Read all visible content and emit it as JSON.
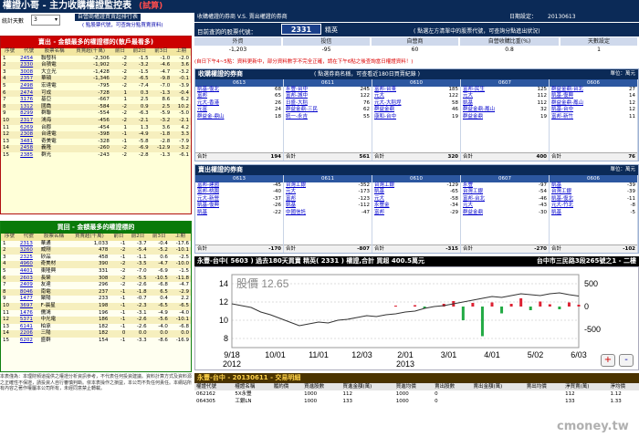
{
  "header": {
    "title": "權證小哥 - 主力收購權證監控表",
    "title_tag": "(試算)"
  },
  "left": {
    "days_label": "統計天數",
    "days_value": "3",
    "hint_line1": "自營商權證買賣超排行表",
    "hint_line2": "( 點股票代號，可查詢分點買賣資料)",
    "buy_title": "賣出 - 金額最多的權證標的(散戶最看多)",
    "sell_title": "買回 - 金額最多的權證標的",
    "cols": [
      "序號",
      "代號",
      "股票名稱",
      "買賣超(千萬)",
      "前日",
      "前2日",
      "前3日",
      "上期"
    ],
    "buy_rows": [
      [
        "1",
        "2454",
        "聯發科",
        "-2,306",
        "-2",
        "-1.5",
        "-1.0",
        "-2.0"
      ],
      [
        "2",
        "2330",
        "台積電",
        "-1,902",
        "-2",
        "-3.2",
        "-4.6",
        "3.6"
      ],
      [
        "3",
        "3008",
        "大立光",
        "-1,428",
        "-2",
        "-1.5",
        "-4.7",
        "-3.2"
      ],
      [
        "4",
        "2357",
        "華碩",
        "-1,346",
        "-2",
        "-6.5",
        "-9.8",
        "-0.1"
      ],
      [
        "5",
        "2498",
        "宏達電",
        "-795",
        "-2",
        "-7.4",
        "-7.0",
        "-3.9"
      ],
      [
        "6",
        "2474",
        "可成",
        "-728",
        "1",
        "0.3",
        "-1.3",
        "-0.4"
      ],
      [
        "7",
        "3176",
        "基亞",
        "-667",
        "1",
        "2.5",
        "8.6",
        "6.2"
      ],
      [
        "8",
        "1312",
        "國喬",
        "-584",
        "-2",
        "0.9",
        "2.5",
        "10.2"
      ],
      [
        "9",
        "8299",
        "群聯",
        "-554",
        "-2",
        "-6.3",
        "-5.9",
        "-5.0"
      ],
      [
        "10",
        "2317",
        "鴻海",
        "-456",
        "-2",
        "-2.1",
        "-3.2",
        "-2.1"
      ],
      [
        "11",
        "6269",
        "台郡",
        "-454",
        "1",
        "1.3",
        "3.6",
        "4.2"
      ],
      [
        "12",
        "2308",
        "台達電",
        "-398",
        "-1",
        "-4.9",
        "-1.8",
        "3.3"
      ],
      [
        "13",
        "3481",
        "奇美電",
        "-328",
        "-1",
        "-5.8",
        "-2.8",
        "-7.9"
      ],
      [
        "14",
        "2458",
        "義隆",
        "-260",
        "-2",
        "-6.9",
        "-12.9",
        "-3.2"
      ],
      [
        "15",
        "2385",
        "群光",
        "-243",
        "-2",
        "-2.8",
        "-1.3",
        "-6.1"
      ]
    ],
    "sell_rows": [
      [
        "1",
        "2313",
        "華通",
        "1,033",
        "-1",
        "-3.7",
        "-0.4",
        "-17.6"
      ],
      [
        "2",
        "3260",
        "威剛",
        "478",
        "-2",
        "-5.4",
        "-5.2",
        "-10.1"
      ],
      [
        "3",
        "2325",
        "矽品",
        "458",
        "-1",
        "-1.1",
        "0.6",
        "-2.5"
      ],
      [
        "4",
        "4960",
        "奇美材",
        "390",
        "-2",
        "-3.5",
        "-4.7",
        "-10.0"
      ],
      [
        "5",
        "4401",
        "東隆興",
        "331",
        "-2",
        "-7.0",
        "-6.9",
        "-1.5"
      ],
      [
        "6",
        "2603",
        "長榮",
        "308",
        "-2",
        "-5.5",
        "-10.5",
        "-11.8"
      ],
      [
        "7",
        "2409",
        "友達",
        "296",
        "-2",
        "-2.6",
        "-6.8",
        "-4.7"
      ],
      [
        "8",
        "8046",
        "南電",
        "237",
        "-1",
        "-1.8",
        "6.5",
        "-2.9"
      ],
      [
        "9",
        "1477",
        "聚陽",
        "233",
        "-1",
        "-0.7",
        "0.4",
        "2.2"
      ],
      [
        "10",
        "3697",
        "F-晨星",
        "198",
        "-1",
        "-2.3",
        "-6.5",
        "-6.5"
      ],
      [
        "11",
        "1476",
        "儒鴻",
        "196",
        "-1",
        "-3.1",
        "-4.9",
        "-4.0"
      ],
      [
        "12",
        "5371",
        "中光電",
        "186",
        "-1",
        "-2.6",
        "-5.6",
        "-10.1"
      ],
      [
        "13",
        "6141",
        "柏承",
        "182",
        "-1",
        "-2.6",
        "-4.0",
        "-6.8"
      ],
      [
        "14",
        "2206",
        "三陽",
        "182",
        "0",
        "0.0",
        "0.0",
        "0.0"
      ],
      [
        "15",
        "6202",
        "盛群",
        "154",
        "-1",
        "-3.3",
        "-8.6",
        "-16.9"
      ]
    ],
    "note": "本表僅為：本理財頻道提供之權證分析資訊參考，不代表任何投資建議。資料計算方式及資料源之正確性不保證，請投資人自行審慎判斷。依本表操作之損益，本公司不負任何責任。本網站所有內容之著作權屬本公司所有，未經同意禁止轉載。"
  },
  "info": {
    "header_left": "收購權證的券商 V.S. 賣出權證的券商",
    "date_label": "日期設定：",
    "date_value": "20130613",
    "stock_label": "目前查詢的股票代號：",
    "stock_code": "2331",
    "stock_name": "精英",
    "stock_hint": "( 點選左方清單中的股票代號，可查詢分點進出狀況)",
    "metric_heads": [
      "外資",
      "投信",
      "自營商",
      "自營收購比重(%)",
      "天數設定"
    ],
    "metric_vals": [
      "-1,203",
      "-95",
      "60",
      "0.8",
      "1"
    ],
    "red_note": "(自日下午4~5點：資料更新中，部分資料數字不完全正確，請在下午6點之後查詢當日權證資料！)"
  },
  "buy_section": {
    "title": "收購權證的券商",
    "sub": "( 點選券商名稱，可查看近180日買賣紀錄 )",
    "unit": "單位：萬元",
    "dates": [
      "0613",
      "0611",
      "0610",
      "0607",
      "0606"
    ],
    "cols": [
      {
        "rows": [
          [
            "凱基-復北",
            "68"
          ],
          [
            "富邦",
            "65"
          ],
          [
            "元大-香港",
            "26"
          ],
          [
            "元富",
            "24"
          ],
          [
            "群益金-鼎山",
            "18"
          ]
        ],
        "total": "194"
      },
      {
        "rows": [
          [
            "永豐-台中",
            "245"
          ],
          [
            "富邦-城中",
            "122"
          ],
          [
            "日盛-大稻",
            "76"
          ],
          [
            "群益金鼎-三民",
            "62"
          ],
          [
            "統一-永吉",
            "55"
          ]
        ],
        "total": "561"
      },
      {
        "rows": [
          [
            "富邦-台東",
            "185"
          ],
          [
            "元大",
            "122"
          ],
          [
            "元大-大稻埕",
            "58"
          ],
          [
            "群益金鼎",
            "46"
          ],
          [
            "康和-台中",
            "19"
          ]
        ],
        "total": "320"
      },
      {
        "rows": [
          [
            "富邦-民生",
            "125"
          ],
          [
            "元大",
            "112"
          ],
          [
            "凱基",
            "112"
          ],
          [
            "群益金鼎-鳳山",
            "32"
          ],
          [
            "群益金鼎",
            "19"
          ]
        ],
        "total": "400"
      },
      {
        "rows": [
          [
            "群益金鼎-台北",
            "27"
          ],
          [
            "凱基-復興",
            "14"
          ],
          [
            "群益金鼎-鳳山",
            "12"
          ],
          [
            "凱基-台中",
            "12"
          ],
          [
            "富邦-新竹",
            "11"
          ]
        ],
        "total": "76"
      }
    ],
    "total_label": "合計"
  },
  "sell_section": {
    "title": "賣出權證的券商",
    "unit": "單位：萬元",
    "dates": [
      "0613",
      "0611",
      "0610",
      "0607",
      "0606"
    ],
    "cols": [
      {
        "rows": [
          [
            "富邦-建國",
            "-45"
          ],
          [
            "富邦-桃園",
            "-40"
          ],
          [
            "元大-新營",
            "-37"
          ],
          [
            "凱基-復興",
            "-26"
          ],
          [
            "凱基",
            "-22"
          ]
        ],
        "total": "-170"
      },
      {
        "rows": [
          [
            "台灣工銀",
            "-352"
          ],
          [
            "元大",
            "-173"
          ],
          [
            "富邦",
            "-123"
          ],
          [
            "凱基",
            "-112"
          ],
          [
            "中國信託",
            "-47"
          ]
        ],
        "total": "-807"
      },
      {
        "rows": [
          [
            "台灣工銀",
            "-129"
          ],
          [
            "凱基",
            "-65"
          ],
          [
            "元大",
            "-58"
          ],
          [
            "永豐金",
            "-34"
          ],
          [
            "富邦",
            "-29"
          ]
        ],
        "total": "-315"
      },
      {
        "rows": [
          [
            "永豐",
            "-97"
          ],
          [
            "台灣工銀",
            "-54"
          ],
          [
            "富邦-台北",
            "-46"
          ],
          [
            "元大",
            "-43"
          ],
          [
            "群益金鼎",
            "-30"
          ]
        ],
        "total": "-270"
      },
      {
        "rows": [
          [
            "凱基",
            "-39"
          ],
          [
            "台灣工銀",
            "-39"
          ],
          [
            "凱基-復北",
            "-11"
          ],
          [
            "元大-竹北",
            "-8"
          ],
          [
            "凱基",
            "-5"
          ]
        ],
        "total": "-102"
      }
    ],
    "total_label": "合計"
  },
  "chart_bar": {
    "left": "永豐-台中( 5603 ) 過去180天買賣 精英( 2331 ) 權證,合計 買超 400.5萬元",
    "right": "台中市三民路3段265號之1 - 二樓"
  },
  "chart_data": {
    "type": "line",
    "price_label": "股價 12.65",
    "x_ticks": [
      "9/18",
      "10/01",
      "11/01",
      "12/03",
      "2/01",
      "3/01",
      "4/01",
      "5/02",
      "6/03"
    ],
    "year_ticks": [
      "2012",
      "2013"
    ],
    "y_left": {
      "ticks": [
        "8",
        "10",
        "12",
        "14"
      ],
      "range": [
        7,
        15
      ]
    },
    "y_right": {
      "ticks": [
        "500",
        "0",
        "-500"
      ],
      "range": [
        -900,
        700
      ]
    },
    "price": [
      11.8,
      11.6,
      11.4,
      10.9,
      10.6,
      10.2,
      9.8,
      9.4,
      9.6,
      9.8,
      9.7,
      10.0,
      10.1,
      10.3,
      10.5,
      10.4,
      10.6,
      10.7,
      10.9,
      11.0,
      11.3,
      11.5,
      11.6,
      11.8,
      12.0,
      12.2,
      12.4,
      12.6,
      12.5,
      12.7,
      12.9,
      12.8,
      12.7,
      12.9,
      13.0,
      12.8,
      12.65
    ],
    "bars": [
      0,
      0,
      0,
      0,
      0,
      0,
      0,
      0,
      0,
      0,
      0,
      0,
      0,
      0,
      0,
      0,
      0,
      20,
      0,
      30,
      -40,
      0,
      60,
      120,
      -300,
      80,
      -650,
      90,
      -150,
      60,
      180,
      -80,
      110,
      50,
      -60,
      90,
      40
    ]
  },
  "zoom": {
    "in": "+",
    "out": "-"
  },
  "trades": {
    "title": "永豐-台中 - 20130611 - 交易明細",
    "cols": [
      "權證代號",
      "權證名稱",
      "履約價",
      "買進股數",
      "買進金額(萬)",
      "買進均價",
      "賣出股數",
      "賣出金額(萬)",
      "賣出均價",
      "淨買賣(萬)",
      "淨均價"
    ],
    "rows": [
      [
        "062162",
        "5X永豐",
        "",
        "1000",
        "112",
        "1000",
        "0",
        "",
        "",
        "112",
        "1.12"
      ],
      [
        "064305",
        "工銀LN",
        "",
        "1000",
        "133",
        "1000",
        "0",
        "",
        "",
        "133",
        "1.33"
      ]
    ]
  },
  "watermark": "cmoney.tw"
}
